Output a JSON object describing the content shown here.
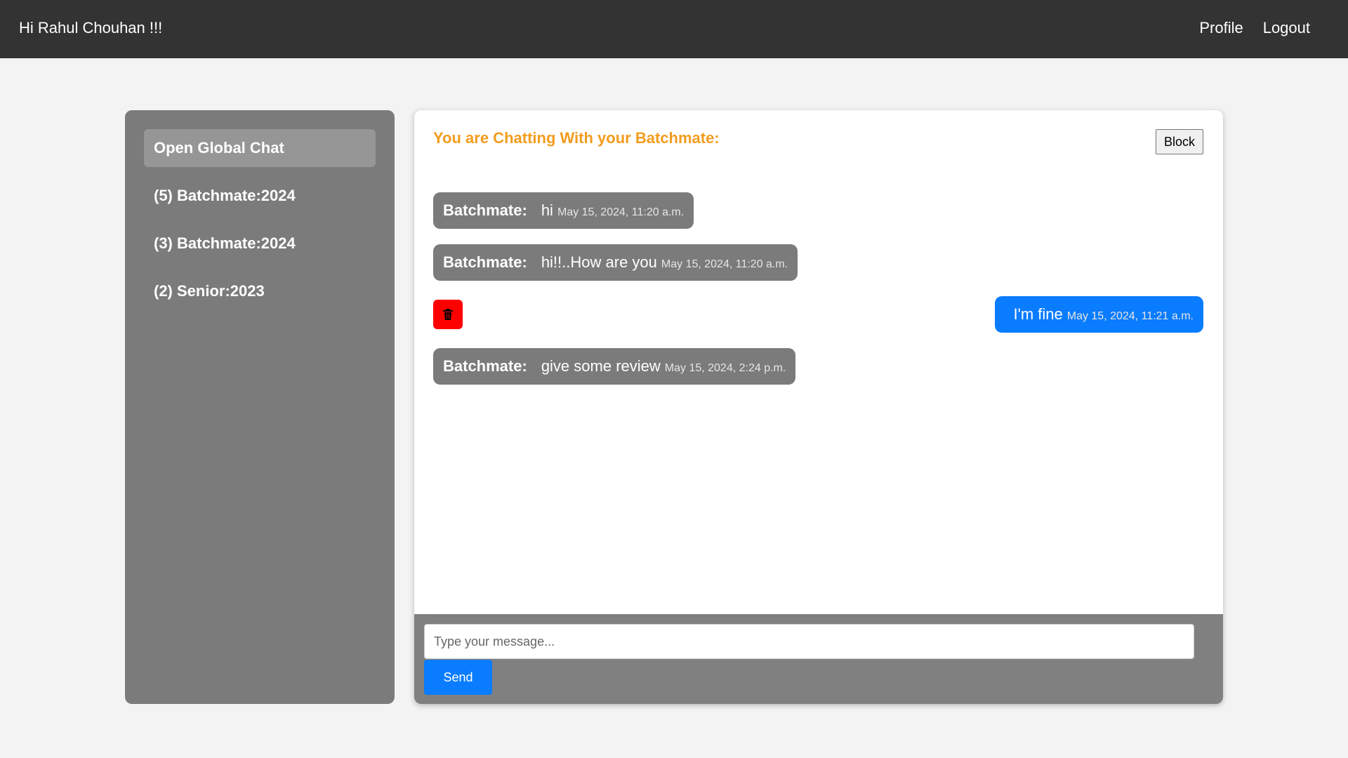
{
  "header": {
    "greeting": "Hi Rahul Chouhan !!!",
    "nav": [
      {
        "label": "Profile"
      },
      {
        "label": "Logout"
      }
    ]
  },
  "sidebar": {
    "items": [
      {
        "label": "Open Global Chat",
        "active": true
      },
      {
        "label": "(5) Batchmate:2024"
      },
      {
        "label": "(3) Batchmate:2024"
      },
      {
        "label": "(2) Senior:2023"
      }
    ]
  },
  "chat": {
    "title": "You are Chatting With your Batchmate:",
    "block_label": "Block",
    "messages": [
      {
        "direction": "received",
        "sender": "Batchmate:",
        "text": "hi",
        "time": "May 15, 2024, 11:20 a.m."
      },
      {
        "direction": "received",
        "sender": "Batchmate:",
        "text": "hi!!..How are you",
        "time": "May 15, 2024, 11:20 a.m."
      },
      {
        "direction": "sent",
        "text": "I'm fine",
        "time": "May 15, 2024, 11:21 a.m.",
        "delete_icon": "trash-icon"
      },
      {
        "direction": "received",
        "sender": "Batchmate:",
        "text": "give some review",
        "time": "May 15, 2024, 2:24 p.m."
      }
    ],
    "input_placeholder": "Type your message...",
    "send_label": "Send"
  },
  "colors": {
    "topbar": "#333333",
    "sidebar": "#7b7b7b",
    "sidebar_active": "#969696",
    "title": "#f39c1f",
    "sent_bubble": "#0a7cff",
    "received_bubble": "#7b7b7b",
    "delete": "#ff0000"
  }
}
